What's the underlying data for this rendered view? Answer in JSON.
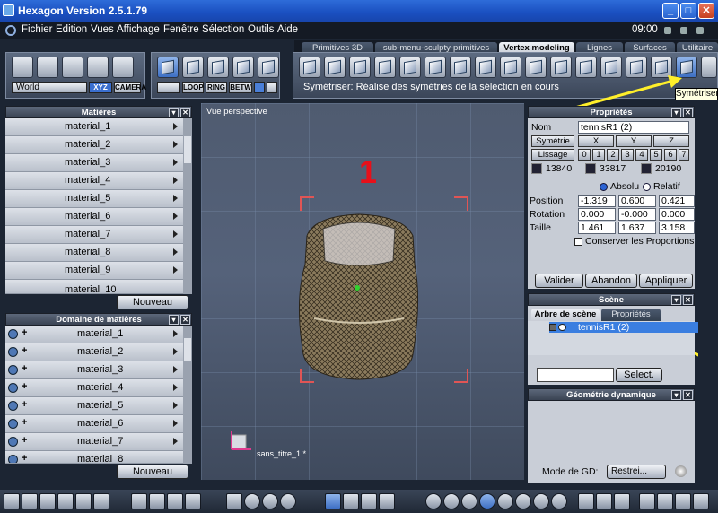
{
  "window": {
    "title": "Hexagon Version 2.5.1.79",
    "min": "_",
    "max": "□",
    "close": "✕"
  },
  "menu": {
    "items": [
      "Fichier",
      "Edition",
      "Vues",
      "Affichage",
      "Fenêtre",
      "Sélection",
      "Outils",
      "Aide"
    ],
    "time": "09:00"
  },
  "tabs": [
    "Primitives 3D",
    "sub-menu-sculpty-primitives",
    "Vertex modeling",
    "Lignes",
    "Surfaces",
    "Utilitaire"
  ],
  "toolbar": {
    "world_select": "World",
    "xyz_label": "XYZ",
    "camera_label": "CAMERA",
    "loop": "LOOP",
    "ring": "RING",
    "betw": "BETW"
  },
  "status": "Symétriser: Réalise des symétries de la sélection en cours",
  "tooltip": "Symétriser",
  "materials": {
    "title": "Matières",
    "items": [
      "material_1",
      "material_2",
      "material_3",
      "material_4",
      "material_5",
      "material_6",
      "material_7",
      "material_8",
      "material_9",
      "material_10"
    ],
    "new_button": "Nouveau"
  },
  "domain": {
    "title": "Domaine de matières",
    "items": [
      "material_1",
      "material_2",
      "material_3",
      "material_4",
      "material_5",
      "material_6",
      "material_7",
      "material_8"
    ],
    "new_button": "Nouveau"
  },
  "viewport": {
    "label": "Vue perspective",
    "annotation": "1",
    "scene_name": "sans_titre_1 *"
  },
  "properties": {
    "title": "Propriétés",
    "name_label": "Nom",
    "name_value": "tennisR1 (2)",
    "symmetry": "Symétrie",
    "x": "X",
    "y": "Y",
    "z": "Z",
    "smoothing": "Lissage",
    "smooth_levels": [
      "0",
      "1",
      "2",
      "3",
      "4",
      "5",
      "6",
      "7"
    ],
    "counts": [
      "13840",
      "33817",
      "20190"
    ],
    "absolute": "Absolu",
    "relative": "Relatif",
    "position_label": "Position",
    "position": [
      "-1.319",
      "0.600",
      "0.421"
    ],
    "rotation_label": "Rotation",
    "rotation": [
      "0.000",
      "-0.000",
      "0.000"
    ],
    "size_label": "Taille",
    "size": [
      "1.461",
      "1.637",
      "3.158"
    ],
    "keep_proportions": "Conserver les Proportions",
    "validate": "Valider",
    "cancel": "Abandon",
    "apply": "Appliquer"
  },
  "scene": {
    "title": "Scène",
    "tab_tree": "Arbre de scène",
    "tab_props": "Propriétés",
    "item": "tennisR1 (2)",
    "select_button": "Select."
  },
  "dyngeo": {
    "title": "Géométrie dynamique",
    "mode_label": "Mode de GD:",
    "mode_value": "Restrei..."
  }
}
